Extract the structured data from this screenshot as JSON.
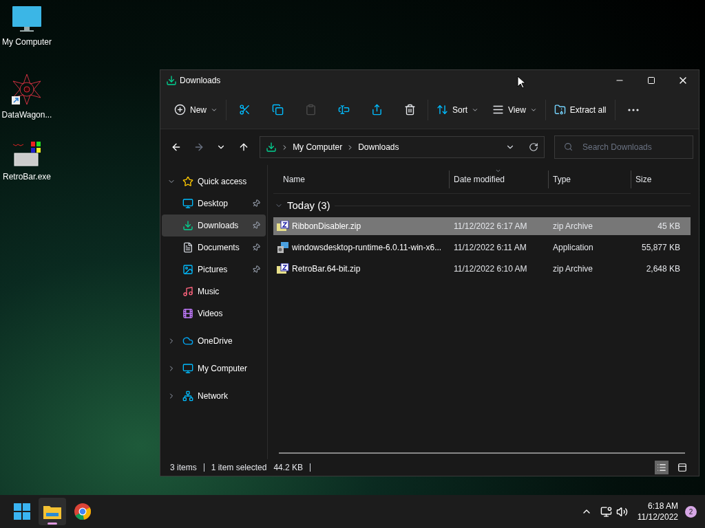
{
  "desktop_icons": [
    {
      "label": "My Computer",
      "kind": "computer"
    },
    {
      "label": "DataWagon...",
      "kind": "shortcut"
    },
    {
      "label": "RetroBar.exe",
      "kind": "program"
    }
  ],
  "window": {
    "title": "Downloads"
  },
  "toolbar": [
    {
      "kind": "new",
      "label": "New",
      "dropdown": true,
      "disabled": false
    },
    {
      "kind": "cut",
      "disabled": false
    },
    {
      "kind": "copy",
      "disabled": false
    },
    {
      "kind": "paste",
      "disabled": true
    },
    {
      "kind": "rename",
      "disabled": false
    },
    {
      "kind": "share",
      "disabled": false
    },
    {
      "kind": "delete",
      "disabled": false
    },
    {
      "kind": "sort",
      "label": "Sort",
      "dropdown": true,
      "disabled": false
    },
    {
      "kind": "view",
      "label": "View",
      "dropdown": true,
      "disabled": false
    },
    {
      "kind": "extract",
      "label": "Extract all",
      "dropdown": false,
      "disabled": false
    },
    {
      "kind": "more",
      "disabled": false
    }
  ],
  "nav": [
    {
      "kind": "back",
      "disabled": false
    },
    {
      "kind": "forward",
      "disabled": true
    },
    {
      "kind": "recent",
      "disabled": false
    },
    {
      "kind": "up",
      "disabled": false
    }
  ],
  "address": {
    "path": [
      "My Computer",
      "Downloads"
    ]
  },
  "search": {
    "placeholder": "Search Downloads"
  },
  "sidebar": [
    {
      "label": "Quick access",
      "kind": "star",
      "expanded": true,
      "selected": false,
      "children": [
        {
          "label": "Desktop",
          "kind": "desktop",
          "pinned": true,
          "selected": false
        },
        {
          "label": "Downloads",
          "kind": "downloads",
          "pinned": true,
          "selected": true
        },
        {
          "label": "Documents",
          "kind": "documents",
          "pinned": true,
          "selected": false
        },
        {
          "label": "Pictures",
          "kind": "pictures",
          "pinned": true,
          "selected": false
        },
        {
          "label": "Music",
          "kind": "music",
          "pinned": false,
          "selected": false
        },
        {
          "label": "Videos",
          "kind": "videos",
          "pinned": false,
          "selected": false
        }
      ]
    },
    {
      "label": "OneDrive",
      "kind": "cloud",
      "expanded": false,
      "selected": false
    },
    {
      "label": "My Computer",
      "kind": "computer",
      "expanded": false,
      "selected": false
    },
    {
      "label": "Network",
      "kind": "network",
      "expanded": false,
      "selected": false
    }
  ],
  "columns": [
    {
      "label": "Name",
      "sorted": false
    },
    {
      "label": "Date modified",
      "sorted": true
    },
    {
      "label": "Type",
      "sorted": false
    },
    {
      "label": "Size",
      "sorted": false
    }
  ],
  "group": {
    "label": "Today (3)",
    "expanded": true
  },
  "rows": [
    {
      "kind": "zip",
      "name": "RibbonDisabler.zip",
      "date": "11/12/2022 6:17 AM",
      "type": "zip Archive",
      "size": "45 KB",
      "selected": true
    },
    {
      "kind": "app",
      "name": "windowsdesktop-runtime-6.0.11-win-x6...",
      "date": "11/12/2022 6:11 AM",
      "type": "Application",
      "size": "55,877 KB",
      "selected": false
    },
    {
      "kind": "zip",
      "name": "RetroBar.64-bit.zip",
      "date": "11/12/2022 6:10 AM",
      "type": "zip Archive",
      "size": "2,648 KB",
      "selected": false
    }
  ],
  "status_bar": {
    "count": "3 items",
    "selection": "1 item selected",
    "size": "44.2 KB"
  },
  "view_buttons": [
    {
      "kind": "details",
      "selected": true
    },
    {
      "kind": "tiles",
      "selected": false
    }
  ],
  "taskbar": {
    "apps": [
      {
        "kind": "start",
        "active": false
      },
      {
        "kind": "explorer",
        "active": true
      },
      {
        "kind": "browser",
        "active": false
      }
    ],
    "time": "6:18 AM",
    "date": "11/12/2022",
    "notifications": "2"
  }
}
